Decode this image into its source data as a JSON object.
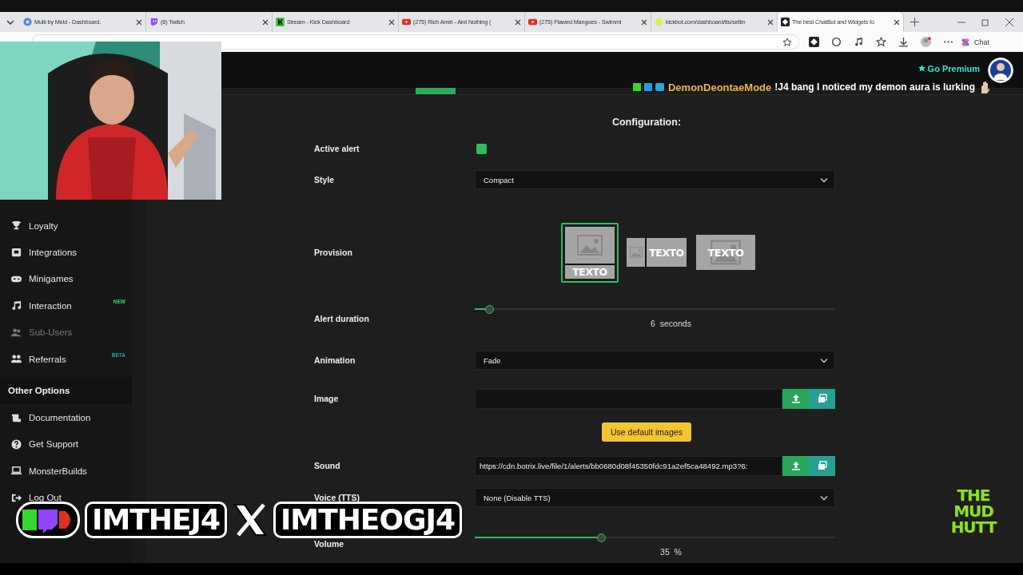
{
  "browser": {
    "tabs": [
      {
        "kind": "meld",
        "title": "Multi by Meld - Dashboard.",
        "selected": false
      },
      {
        "kind": "twitch",
        "title": "(6) Twitch",
        "selected": false
      },
      {
        "kind": "kick",
        "title": "Stream - Kick Dashboard",
        "selected": false
      },
      {
        "kind": "youtube",
        "title": "(275) Rich Amiri - Aint Nothing (",
        "selected": false
      },
      {
        "kind": "youtube",
        "title": "(275) Flawed Mangoes - Swimmi",
        "selected": false
      },
      {
        "kind": "kickbot",
        "title": "kickbot.com/dashboard/tts/settin",
        "selected": false
      },
      {
        "kind": "botrix",
        "title": "The best ChatBot and Widgets fo",
        "selected": true
      }
    ],
    "chat_button": "Chat"
  },
  "header": {
    "premium": "Go Premium"
  },
  "chat_overlay": {
    "user": "DemonDeontaeMode",
    "message": "!J4 bang I noticed my demon aura is lurking"
  },
  "sidebar": {
    "items": [
      {
        "label": "Loyalty",
        "disabled": false
      },
      {
        "label": "Integrations",
        "disabled": false
      },
      {
        "label": "Minigames",
        "disabled": false
      },
      {
        "label": "Interaction",
        "disabled": false,
        "badge": {
          "text": "NEW",
          "color": "#3fd46a"
        }
      },
      {
        "label": "Sub-Users",
        "disabled": true
      },
      {
        "label": "Referrals",
        "disabled": false,
        "badge": {
          "text": "BETA",
          "color": "#1fa9a0"
        }
      }
    ],
    "section": "Other Options",
    "other_items": [
      {
        "label": "Documentation",
        "disabled": false
      },
      {
        "label": "Get Support",
        "disabled": false
      },
      {
        "label": "MonsterBuilds",
        "disabled": false
      },
      {
        "label": "Log Out",
        "disabled": false
      }
    ]
  },
  "config": {
    "title": "Configuration:",
    "active_alert": {
      "label": "Active alert",
      "checked": true
    },
    "style": {
      "label": "Style",
      "value": "Compact"
    },
    "provision": {
      "label": "Provision",
      "options": [
        {
          "kind": "stacked",
          "label": "TEXTO",
          "selected": true
        },
        {
          "kind": "side",
          "label": "TEXTO",
          "selected": false
        },
        {
          "kind": "overlay",
          "label": "TEXTO",
          "selected": false
        }
      ]
    },
    "alert_duration": {
      "label": "Alert duration",
      "level": 0.04,
      "value": "6",
      "unit": "seconds"
    },
    "animation": {
      "label": "Animation",
      "value": "Fade"
    },
    "image": {
      "label": "Image"
    },
    "default_button": "Use default images",
    "sound": {
      "label": "Sound",
      "value": "https://cdn.botrix.live/file/1/alerts/bb0680d08f45350fdc91a2ef5ca48492.mp3?6:"
    },
    "voice": {
      "label": "Voice (TTS)",
      "value": "None (Disable TTS)"
    },
    "volume": {
      "label": "Volume",
      "level": 0.35,
      "value": "35",
      "unit": "%"
    }
  },
  "stream_overlay": {
    "names": [
      "IMTHEJ4",
      "IMTHEOGJ4"
    ],
    "logo": "THE MUD HUTT"
  }
}
